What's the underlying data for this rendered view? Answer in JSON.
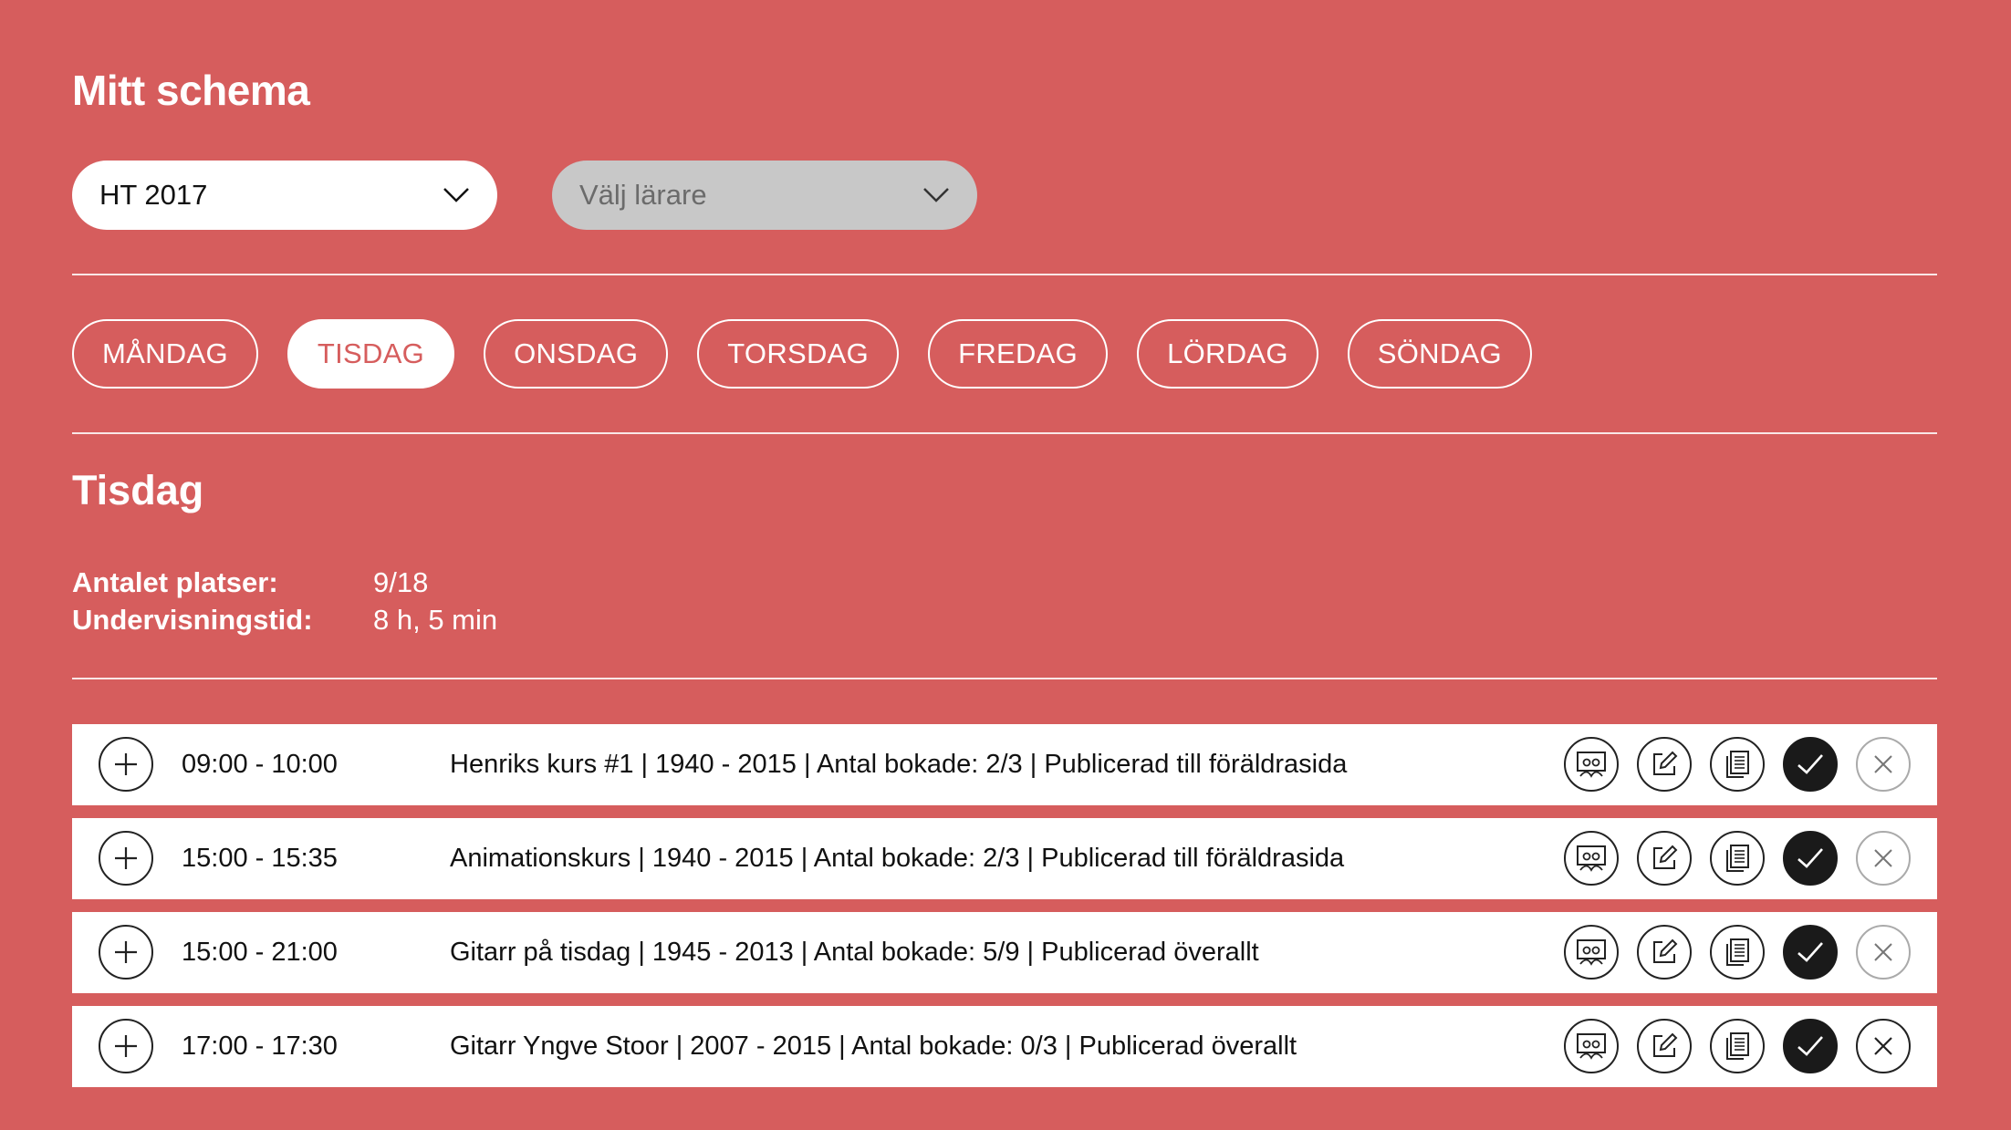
{
  "page": {
    "title": "Mitt schema"
  },
  "filters": {
    "term_value": "HT 2017",
    "teacher_placeholder": "Välj lärare"
  },
  "days": [
    "MÅNDAG",
    "TISDAG",
    "ONSDAG",
    "TORSDAG",
    "FREDAG",
    "LÖRDAG",
    "SÖNDAG"
  ],
  "selected_day_index": 1,
  "day_view": {
    "title": "Tisdag",
    "stats": [
      {
        "label": "Antalet platser:",
        "value": "9/18"
      },
      {
        "label": "Undervisningstid:",
        "value": "8 h, 5 min"
      }
    ]
  },
  "lessons": [
    {
      "time": "09:00 - 10:00",
      "description": "Henriks kurs #1 | 1940 - 2015 | Antal bokade: 2/3 | Publicerad till föräldrasida",
      "close_faint": true
    },
    {
      "time": "15:00 - 15:35",
      "description": "Animationskurs | 1940 - 2015 | Antal bokade: 2/3 | Publicerad till föräldrasida",
      "close_faint": true
    },
    {
      "time": "15:00 - 21:00",
      "description": "Gitarr på tisdag | 1945 - 2013 | Antal bokade: 5/9 | Publicerad överallt",
      "close_faint": true
    },
    {
      "time": "17:00 - 17:30",
      "description": "Gitarr Yngve Stoor | 2007 - 2015 | Antal bokade: 0/3 | Publicerad överallt",
      "close_faint": false
    }
  ],
  "icons": {
    "add": "plus-icon",
    "actions": [
      "students-icon",
      "edit-icon",
      "copy-icon",
      "check-icon",
      "close-icon"
    ]
  },
  "colors": {
    "background": "#d65d5d",
    "active_day_text": "#d65d5d",
    "check_button": "#1a1a1a"
  }
}
